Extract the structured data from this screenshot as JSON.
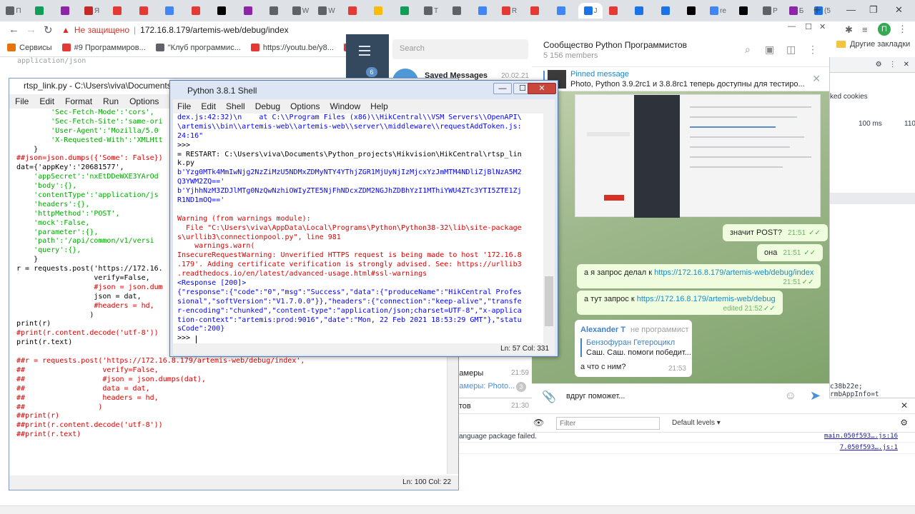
{
  "browser": {
    "tabs": [
      {
        "label": "П",
        "color": "#5f6368"
      },
      {
        "label": "",
        "color": "#0f9d58"
      },
      {
        "label": "",
        "color": "#8e24aa"
      },
      {
        "label": "Я",
        "color": "#c62828"
      },
      {
        "label": "",
        "color": "#e53935"
      },
      {
        "label": "",
        "color": "#e53935"
      },
      {
        "label": "",
        "color": "#4285f4"
      },
      {
        "label": "",
        "color": "#e53935"
      },
      {
        "label": "",
        "color": "#000000"
      },
      {
        "label": "",
        "color": "#8e24aa"
      },
      {
        "label": "",
        "color": "#5f6368"
      },
      {
        "label": "W",
        "color": "#5f6368"
      },
      {
        "label": "W",
        "color": "#5f6368"
      },
      {
        "label": "",
        "color": "#e53935"
      },
      {
        "label": "",
        "color": "#fbbc04"
      },
      {
        "label": "",
        "color": "#0f9d58"
      },
      {
        "label": "Т",
        "color": "#5f6368"
      },
      {
        "label": "",
        "color": "#5f6368"
      },
      {
        "label": "",
        "color": "#4285f4"
      },
      {
        "label": "R",
        "color": "#e53935"
      },
      {
        "label": "",
        "color": "#e53935"
      },
      {
        "label": "",
        "color": "#4285f4"
      },
      {
        "label": "J",
        "color": "#1a73e8"
      },
      {
        "label": "",
        "color": "#e53935"
      },
      {
        "label": "",
        "color": "#1a73e8"
      },
      {
        "label": "",
        "color": "#1a73e8"
      },
      {
        "label": "",
        "color": "#000000"
      },
      {
        "label": "re",
        "color": "#4285f4"
      },
      {
        "label": "",
        "color": "#000000"
      },
      {
        "label": "P",
        "color": "#5f6368"
      },
      {
        "label": "Б",
        "color": "#8e24aa"
      },
      {
        "label": "(5",
        "color": "#1a73e8"
      }
    ],
    "new_tab": "+",
    "security_label": "Не защищено",
    "url": "172.16.8.179/artemis-web/debug/index",
    "bookmarks": [
      {
        "label": "Сервисы",
        "color": "#e8710a"
      },
      {
        "label": "#9 Программиров...",
        "color": "#e53935"
      },
      {
        "label": "\"Клуб программис...",
        "color": "#5f6368"
      },
      {
        "label": "https://youtu.be/y8...",
        "color": "#e53935"
      },
      {
        "label": "Па",
        "color": "#e53935"
      }
    ],
    "other_bookmarks": "Другие закладки",
    "profile_initial": "П"
  },
  "background_page": {
    "ghost_text": "application/json"
  },
  "devtools": {
    "cookies_text": "ked cookies",
    "ms_value": "100 ms",
    "num_value": "110",
    "cookie_line": "c38b22e; rmbAppInfo=t",
    "filter_placeholder": "Filter",
    "levels_label": "Default levels ▾",
    "logs": [
      {
        "message": "anguage package failed.",
        "source": "main.050f593….js:16"
      },
      {
        "message": "",
        "source": "7.050f593….js:1"
      }
    ]
  },
  "telegram": {
    "search_placeholder": "Search",
    "badge": "6",
    "saved_messages": "Saved Messages",
    "saved_date": "20.02.21",
    "chats": [
      {
        "name": "Камеры",
        "time": "21:59"
      },
      {
        "name": "Камеры: Photo...",
        "time": "",
        "unread": "3"
      },
      {
        "name": "атов",
        "time": "21:30"
      }
    ],
    "title": "Сообщество Python Программистов",
    "members": "5 156 members",
    "pinned_title": "Pinned message",
    "pinned_text": "Photo, Python 3.9.2rc1 и 3.8.8rc1 теперь доступны для тестиро...",
    "messages": [
      {
        "text": "значит POST?",
        "time": "21:51"
      },
      {
        "text": "она",
        "time": "21:51"
      },
      {
        "text": "а я запрос делал к",
        "link": "https://172.16.8.179/artemis-web/debug/index",
        "time": "21:51"
      },
      {
        "text": "а тут запрос к",
        "link": "https://172.16.8.179/artemis-web/debug",
        "time": "edited 21:52"
      }
    ],
    "reply": {
      "author": "Alexander T",
      "tag": "не программист",
      "quote_author": "Бензофуран Гетероцикл",
      "quote_text": "Саш. Саш. помоги победит...",
      "text": "а что с ним?",
      "time": "21:53"
    },
    "compose_text": "вдруг поможет..."
  },
  "editor": {
    "title": "rtsp_link.py - C:\\Users\\viva\\Documents\\",
    "menu": [
      "File",
      "Edit",
      "Format",
      "Run",
      "Options",
      "Win"
    ],
    "lines": [
      {
        "t": "        'Sec-Fetch-Mode':'cors',",
        "c": "c-str"
      },
      {
        "t": "        'Sec-Fetch-Site':'same-ori",
        "c": "c-str"
      },
      {
        "t": "        'User-Agent':'Mozilla/5.0",
        "c": "c-str"
      },
      {
        "t": "        'X-Requested-With':'XMLHtt",
        "c": "c-str"
      },
      {
        "t": "    }",
        "c": "c-blk"
      },
      {
        "t": "##json=json.dumps({'Some': False})",
        "c": "c-com"
      },
      {
        "t": "dat={'appKey':'20681577',",
        "c": "c-blk"
      },
      {
        "t": "    'appSecret':'nxEtDDeWXE3YArOd",
        "c": "c-str"
      },
      {
        "t": "    'body':{},",
        "c": "c-str"
      },
      {
        "t": "    'contentType':'application/js",
        "c": "c-str"
      },
      {
        "t": "    'headers':{},",
        "c": "c-str"
      },
      {
        "t": "    'httpMethod':'POST',",
        "c": "c-str"
      },
      {
        "t": "    'mock':False,",
        "c": "c-str"
      },
      {
        "t": "    'parameter':{},",
        "c": "c-str"
      },
      {
        "t": "    'path':'/api/common/v1/versi",
        "c": "c-str"
      },
      {
        "t": "    'query':{},",
        "c": "c-str"
      },
      {
        "t": "    }",
        "c": "c-blk"
      },
      {
        "t": "r = requests.post('https://172.16.",
        "c": "c-blk"
      },
      {
        "t": "                  verify=False,",
        "c": "c-blk"
      },
      {
        "t": "                  #json = json.dum",
        "c": "c-com"
      },
      {
        "t": "                  json = dat,",
        "c": "c-blk"
      },
      {
        "t": "                  #headers = hd,",
        "c": "c-com"
      },
      {
        "t": "                 )",
        "c": "c-blk"
      },
      {
        "t": "print(r)",
        "c": "c-blk"
      },
      {
        "t": "#print(r.content.decode('utf-8'))",
        "c": "c-com"
      },
      {
        "t": "print(r.text)",
        "c": "c-blk"
      },
      {
        "t": "",
        "c": "c-blk"
      },
      {
        "t": "##r = requests.post('https://172.16.8.179/artemis-web/debug/index',",
        "c": "c-com"
      },
      {
        "t": "##                  verify=False,",
        "c": "c-com"
      },
      {
        "t": "##                  #json = json.dumps(dat),",
        "c": "c-com"
      },
      {
        "t": "##                  data = dat,",
        "c": "c-com"
      },
      {
        "t": "##                  headers = hd,",
        "c": "c-com"
      },
      {
        "t": "##                 )",
        "c": "c-com"
      },
      {
        "t": "##print(r)",
        "c": "c-com"
      },
      {
        "t": "##print(r.content.decode('utf-8'))",
        "c": "c-com"
      },
      {
        "t": "##print(r.text)",
        "c": "c-com"
      }
    ],
    "status": "Ln: 100   Col: 22"
  },
  "shell": {
    "title": "Python 3.8.1 Shell",
    "menu": [
      "File",
      "Edit",
      "Shell",
      "Debug",
      "Options",
      "Window",
      "Help"
    ],
    "lines": [
      {
        "t": "dex.js:42:32)\\n    at C:\\\\Program Files (x86)\\\\HikCentral\\\\VSM Servers\\\\OpenAPI\\",
        "c": "c-out"
      },
      {
        "t": "\\artemis\\\\bin\\\\artemis-web\\\\artemis-web\\\\server\\\\middleware\\\\requestAddToken.js:",
        "c": "c-out"
      },
      {
        "t": "24:16\"",
        "c": "c-out"
      },
      {
        "t": ">>>",
        "c": "c-blk"
      },
      {
        "t": "= RESTART: C:\\Users\\viva\\Documents\\Python_projects\\Hikvision\\HikCentral\\rtsp_lin",
        "c": "c-blk"
      },
      {
        "t": "k.py",
        "c": "c-blk"
      },
      {
        "t": "b'Yzg0MTk4MmIwNjg2NzZiMzU5NDMxZDMyNTY4YThjZGR1MjUyNjIzMjcxYzJmMTM4NDliZjBlNzA5M2",
        "c": "c-out"
      },
      {
        "t": "Q3YWM2ZQ=='",
        "c": "c-out"
      },
      {
        "t": "b'YjhhNzM3ZDJlMTg0NzQwNzhiOWIyZTE5NjFhNDcxZDM2NGJhZDBhYzI1MThiYWU4ZTc3YTI5ZTE1Zj",
        "c": "c-out"
      },
      {
        "t": "R1ND1mOQ=='",
        "c": "c-out"
      },
      {
        "t": "",
        "c": "c-blk"
      },
      {
        "t": "Warning (from warnings module):",
        "c": "c-err"
      },
      {
        "t": "  File \"C:\\Users\\viva\\AppData\\Local\\Programs\\Python\\Python38-32\\lib\\site-package",
        "c": "c-err"
      },
      {
        "t": "s\\urllib3\\connectionpool.py\", line 981",
        "c": "c-err"
      },
      {
        "t": "    warnings.warn(",
        "c": "c-err"
      },
      {
        "t": "InsecureRequestWarning: Unverified HTTPS request is being made to host '172.16.8",
        "c": "c-err"
      },
      {
        "t": ".179'. Adding certificate verification is strongly advised. See: https://urllib3",
        "c": "c-err"
      },
      {
        "t": ".readthedocs.io/en/latest/advanced-usage.html#ssl-warnings",
        "c": "c-err"
      },
      {
        "t": "<Response [200]>",
        "c": "c-out"
      },
      {
        "t": "{\"response\":{\"code\":\"0\",\"msg\":\"Success\",\"data\":{\"produceName\":\"HikCentral Profes",
        "c": "c-out"
      },
      {
        "t": "sional\",\"softVersion\":\"V1.7.0.0\"}},\"headers\":{\"connection\":\"keep-alive\",\"transfe",
        "c": "c-out"
      },
      {
        "t": "r-encoding\":\"chunked\",\"content-type\":\"application/json;charset=UTF-8\",\"x-applica",
        "c": "c-out"
      },
      {
        "t": "tion-context\":\"artemis:prod:9016\",\"date\":\"Mon, 22 Feb 2021 18:53:29 GMT\"},\"statu",
        "c": "c-out"
      },
      {
        "t": "sCode\":200}",
        "c": "c-out"
      },
      {
        "t": ">>> ",
        "c": "c-blk"
      }
    ],
    "status": "Ln: 57   Col: 331"
  }
}
